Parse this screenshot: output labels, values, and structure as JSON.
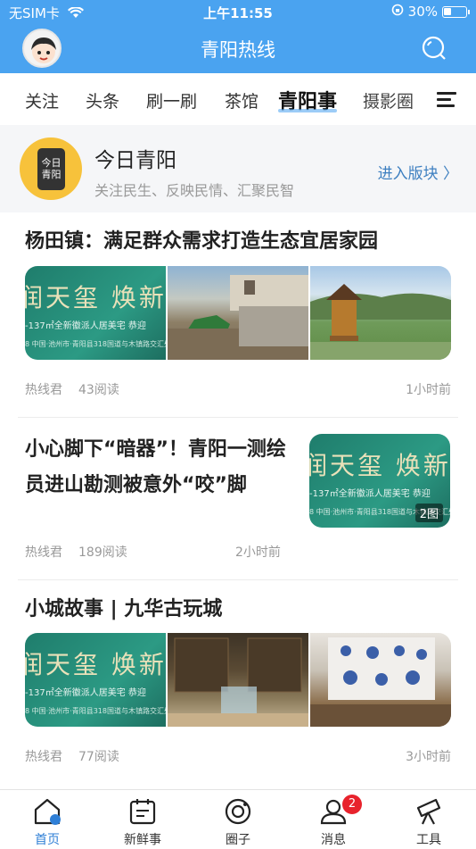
{
  "status_bar": {
    "carrier": "无SIM卡",
    "time": "上午11:55",
    "battery": "30%"
  },
  "header": {
    "title": "青阳热线"
  },
  "tabs": [
    {
      "label": "关注"
    },
    {
      "label": "头条"
    },
    {
      "label": "刷一刷"
    },
    {
      "label": "茶馆"
    },
    {
      "label": "青阳事",
      "active": true
    },
    {
      "label": "摄影圈"
    }
  ],
  "banner": {
    "icon_text_1": "今日",
    "icon_text_2": "青阳",
    "title": "今日青阳",
    "subtitle": "关注民生、反映民情、汇聚民智",
    "enter": "进入版块 〉"
  },
  "ad": {
    "headline": "润天玺 焕新",
    "line2": "-137㎡全新徽派人居美宅 恭迎",
    "line3": "8 中国·池州市·青阳县318国道与木镇路交汇处"
  },
  "articles": [
    {
      "title": "杨田镇：满足群众需求打造生态宜居家园",
      "author": "热线君",
      "reads": "43阅读",
      "time": "1小时前"
    },
    {
      "title": "小心脚下“暗器”！青阳一测绘员进山勘测被意外“咬”脚",
      "author": "热线君",
      "reads": "189阅读",
      "time": "2小时前",
      "pic_count": "2图"
    },
    {
      "title": "小城故事 | 九华古玩城",
      "author": "热线君",
      "reads": "77阅读",
      "time": "3小时前"
    }
  ],
  "bottom_nav": [
    {
      "label": "首页",
      "icon": "home-icon",
      "active": true
    },
    {
      "label": "新鲜事",
      "icon": "calendar-icon"
    },
    {
      "label": "圈子",
      "icon": "circle-icon"
    },
    {
      "label": "消息",
      "icon": "user-icon",
      "badge": "2"
    },
    {
      "label": "工具",
      "icon": "telescope-icon"
    }
  ],
  "colors": {
    "primary": "#4aa3f0",
    "link": "#3d7fc0",
    "badge": "#e8222c"
  }
}
